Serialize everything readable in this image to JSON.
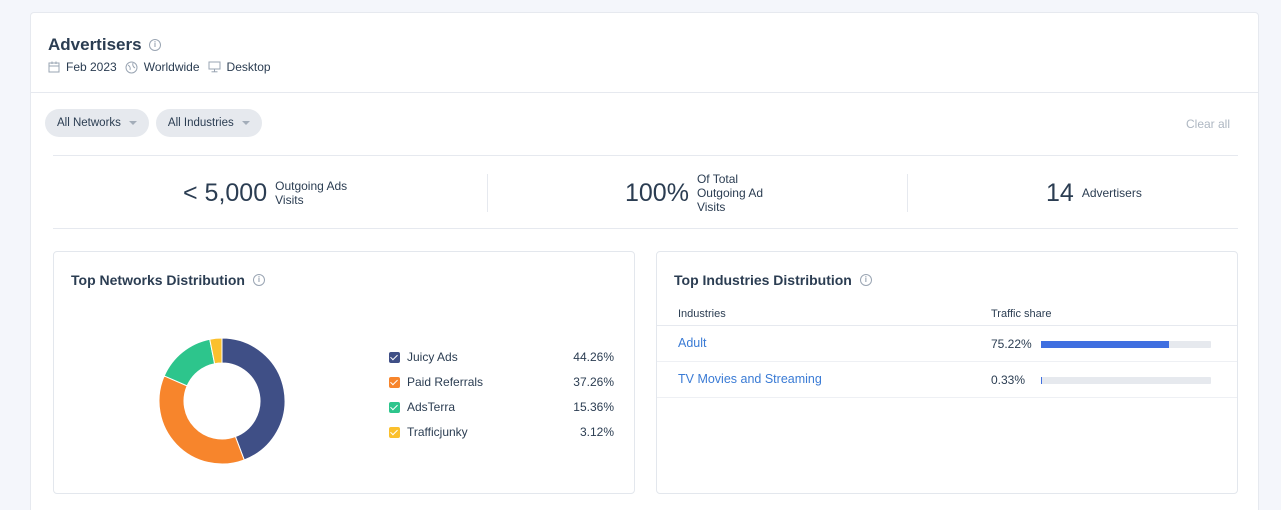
{
  "header": {
    "title": "Advertisers",
    "meta": {
      "date": "Feb 2023",
      "region": "Worldwide",
      "device": "Desktop"
    }
  },
  "filters": {
    "networks": "All Networks",
    "industries": "All Industries",
    "clear": "Clear all"
  },
  "stats": [
    {
      "value": "< 5,000",
      "label_lines": [
        "Outgoing Ads",
        "Visits"
      ]
    },
    {
      "value": "100%",
      "label_lines": [
        "Of Total",
        "Outgoing Ad",
        "Visits"
      ]
    },
    {
      "value": "14",
      "label_lines": [
        "Advertisers"
      ]
    }
  ],
  "networks_panel": {
    "title": "Top Networks Distribution",
    "chart_data": {
      "type": "pie",
      "categories": [
        "Juicy Ads",
        "Paid Referrals",
        "AdsTerra",
        "Trafficjunky"
      ],
      "values": [
        44.26,
        37.26,
        15.36,
        3.12
      ],
      "labels": [
        "44.26%",
        "37.26%",
        "15.36%",
        "3.12%"
      ],
      "colors": [
        "#3f4f86",
        "#f7852c",
        "#2dc58c",
        "#fbc02d"
      ],
      "donut": true,
      "legend": "right"
    }
  },
  "industries_panel": {
    "title": "Top Industries Distribution",
    "columns": [
      "Industries",
      "Traffic share"
    ],
    "rows": [
      {
        "name": "Adult",
        "share_label": "75.22%",
        "share": 75.22
      },
      {
        "name": "TV Movies and Streaming",
        "share_label": "0.33%",
        "share": 0.33
      }
    ]
  }
}
